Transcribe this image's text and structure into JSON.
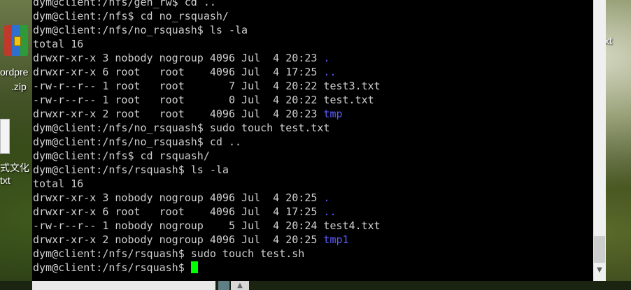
{
  "desktop": {
    "icon1_label_line1": "ordpre",
    "icon1_label_line2": ".zip",
    "icon2_label_line1": "式文化",
    "icon2_label_line2": "txt",
    "right_label": "xt"
  },
  "terminal": {
    "lines": [
      {
        "text": "dym@client:/nfs/gen_rw$ cd .."
      },
      {
        "text": "dym@client:/nfs$ cd no_rsquash/"
      },
      {
        "text": "dym@client:/nfs/no_rsquash$ ls -la"
      },
      {
        "text": "total 16"
      },
      {
        "text": "drwxr-xr-x 3 nobody nogroup 4096 Jul  4 20:23 ",
        "link": "."
      },
      {
        "text": "drwxr-xr-x 6 root   root    4096 Jul  4 17:25 ",
        "link": ".."
      },
      {
        "text": "-rw-r--r-- 1 root   root       7 Jul  4 20:22 test3.txt"
      },
      {
        "text": "-rw-r--r-- 1 root   root       0 Jul  4 20:22 test.txt"
      },
      {
        "text": "drwxr-xr-x 2 root   root    4096 Jul  4 20:23 ",
        "link": "tmp"
      },
      {
        "text": "dym@client:/nfs/no_rsquash$ sudo touch test.txt"
      },
      {
        "text": "dym@client:/nfs/no_rsquash$ cd .."
      },
      {
        "text": "dym@client:/nfs$ cd rsquash/"
      },
      {
        "text": "dym@client:/nfs/rsquash$ ls -la"
      },
      {
        "text": "total 16"
      },
      {
        "text": "drwxr-xr-x 3 nobody nogroup 4096 Jul  4 20:25 ",
        "link": "."
      },
      {
        "text": "drwxr-xr-x 6 root   root    4096 Jul  4 17:25 ",
        "link": ".."
      },
      {
        "text": "-rw-r--r-- 1 nobody nogroup    5 Jul  4 20:24 test4.txt"
      },
      {
        "text": "drwxr-xr-x 2 nobody nogroup 4096 Jul  4 20:25 ",
        "link": "tmp1"
      },
      {
        "text": "dym@client:/nfs/rsquash$ sudo touch test.sh"
      },
      {
        "text": "dym@client:/nfs/rsquash$ ",
        "cursor": true
      }
    ],
    "colors": {
      "text": "#d0d0d0",
      "directory": "#5c5cff",
      "cursor": "#00ff00",
      "background": "#000000"
    }
  },
  "scrollbar": {
    "down_arrow_icon": "chevron-down-icon"
  },
  "taskbar": {
    "item3_glyph": "▲"
  }
}
